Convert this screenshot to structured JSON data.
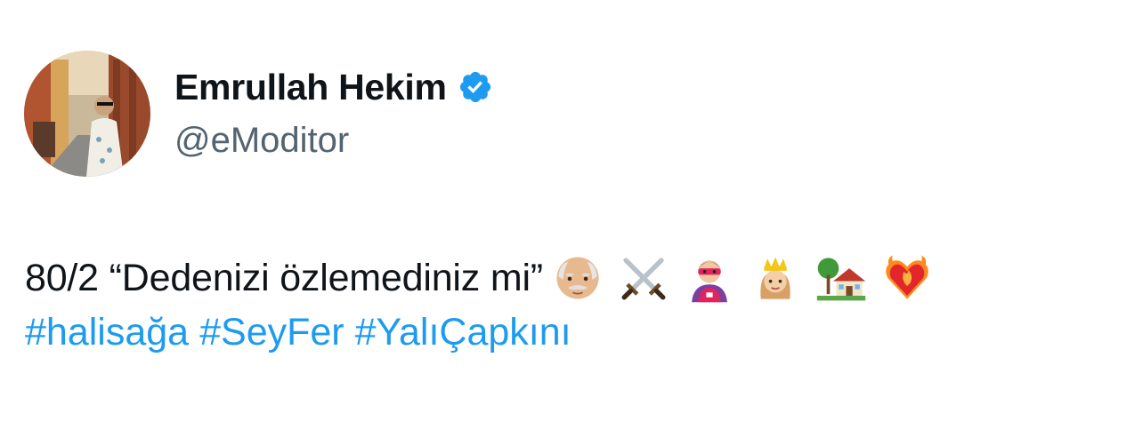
{
  "author": {
    "display_name": "Emrullah Hekim",
    "handle": "@eModitor",
    "verified": true,
    "verified_color": "#1d9bf0"
  },
  "tweet": {
    "text": "80/2 “Dedenizi özlemediniz mi”",
    "emojis": [
      "older-man-emoji",
      "crossed-swords-emoji",
      "superhero-emoji",
      "princess-emoji",
      "house-with-garden-emoji",
      "heart-on-fire-emoji"
    ],
    "hashtags": [
      "#halisağa",
      "#SeyFer",
      "#YalıÇapkını"
    ]
  },
  "colors": {
    "text": "#0f1419",
    "secondary": "#536471",
    "link": "#1d9bf0",
    "background": "#ffffff"
  }
}
